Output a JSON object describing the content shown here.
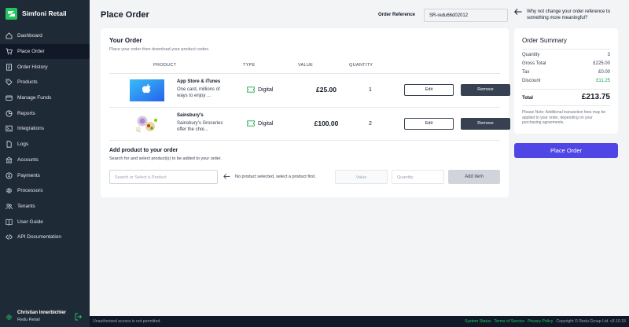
{
  "app": {
    "brand_name": "Simfoni Retail"
  },
  "sidebar": {
    "items": [
      {
        "label": "Dashboard",
        "icon": "home-icon",
        "active": false
      },
      {
        "label": "Place Order",
        "icon": "cart-icon",
        "active": true
      },
      {
        "label": "Order History",
        "icon": "list-icon",
        "active": false
      },
      {
        "label": "Products",
        "icon": "tag-icon",
        "active": false
      },
      {
        "label": "Manage Funds",
        "icon": "wallet-icon",
        "active": false
      },
      {
        "label": "Reports",
        "icon": "chart-icon",
        "active": false
      },
      {
        "label": "Integrations",
        "icon": "terminal-icon",
        "active": false
      },
      {
        "label": "Logs",
        "icon": "doc-icon",
        "active": false
      },
      {
        "label": "Accounts",
        "icon": "building-icon",
        "active": false
      },
      {
        "label": "Payments",
        "icon": "card-icon",
        "active": false
      },
      {
        "label": "Processors",
        "icon": "cog-icon",
        "active": false
      },
      {
        "label": "Tenants",
        "icon": "users-icon",
        "active": false
      },
      {
        "label": "User Guide",
        "icon": "book-icon",
        "active": false
      },
      {
        "label": "API Documentation",
        "icon": "code-icon",
        "active": false
      }
    ]
  },
  "user": {
    "name": "Christian Innerbichler",
    "org": "Redu Retail"
  },
  "header": {
    "title": "Place Order",
    "reference_label": "Order Reference",
    "reference_value": "SR-redu66d02012",
    "hint": "Why not change your order reference to something more meaningful?"
  },
  "order": {
    "title": "Your Order",
    "subtitle": "Place your order then download your product codes.",
    "columns": {
      "product": "PRODUCT",
      "type": "TYPE",
      "value": "VALUE",
      "quantity": "QUANTITY"
    },
    "rows": [
      {
        "name": "App Store & iTunes",
        "desc": "One card, millions of ways to enjoy ...",
        "type": "Digital",
        "value": "£25.00",
        "qty": "1",
        "edit": "Edit",
        "remove": "Remove"
      },
      {
        "name": "Sainsbury's",
        "desc": "Sainsbury's Groceries offer the choi...",
        "type": "Digital",
        "value": "£100.00",
        "qty": "2",
        "edit": "Edit",
        "remove": "Remove"
      }
    ],
    "add": {
      "title": "Add product to your order",
      "subtitle": "Search for and select product(s) to be added to your order.",
      "search_placeholder": "Search or Select a Product",
      "no_selection": "No product selected, select a product first.",
      "value_placeholder": "Value",
      "quantity_placeholder": "Quantity",
      "add_button": "Add item"
    }
  },
  "summary": {
    "title": "Order Summary",
    "quantity_label": "Quantity",
    "quantity": "3",
    "gross_label": "Gross Total",
    "gross": "£225.00",
    "tax_label": "Tax",
    "tax": "£0.00",
    "discount_label": "Discount",
    "discount": "£11.25",
    "total_label": "Total",
    "total": "£213.75",
    "note": "Please Note: Additional transaction fees may be applied to your order, depending on your purchasing agreements.",
    "place_button": "Place Order"
  },
  "footer": {
    "unauth": "Unauthorised access is not permitted.",
    "system_status": "System Status",
    "terms": "Terms of Service",
    "privacy": "Privacy Policy",
    "copyright": "Copyright © Redu Group Ltd. v3.10.15"
  },
  "colors": {
    "sidebar": "#1f2a37",
    "accent": "#4f46e5",
    "brand_green": "#22c55e",
    "discount": "#16a34a"
  }
}
